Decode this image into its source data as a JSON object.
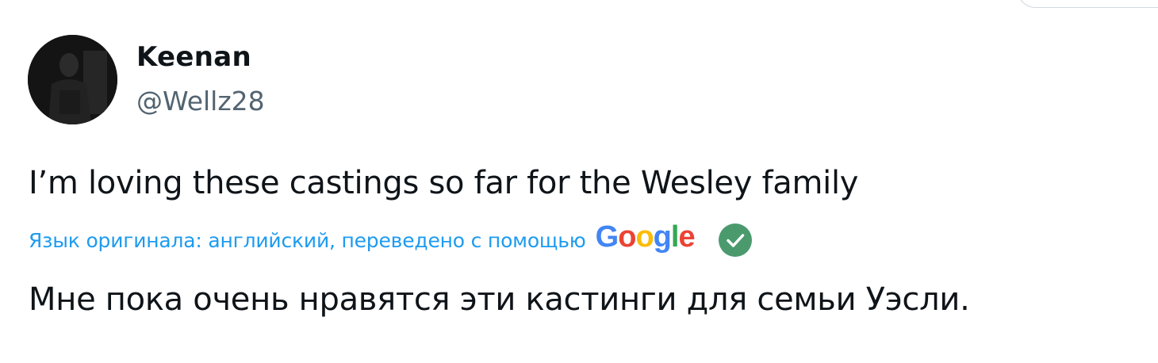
{
  "tweet": {
    "user": {
      "name": "Keenan",
      "handle": "@Wellz28"
    },
    "text": "I’m loving these castings so far for the Wesley family",
    "translation": {
      "label": "Язык оригинала: английский, переведено с помощью",
      "provider": "Google",
      "provider_letters": [
        "G",
        "o",
        "o",
        "g",
        "l",
        "e"
      ],
      "text": "Мне пока очень нравятся эти кастинги для семьи Уэсли."
    }
  },
  "colors": {
    "link": "#1d9bf0",
    "secondary": "#536471",
    "verified_check_bg": "#4a9a6d",
    "google": [
      "#4285f4",
      "#ea4335",
      "#fbbc05",
      "#4285f4",
      "#34a853",
      "#ea4335"
    ]
  },
  "icons": {
    "check": "check-circle-icon"
  }
}
